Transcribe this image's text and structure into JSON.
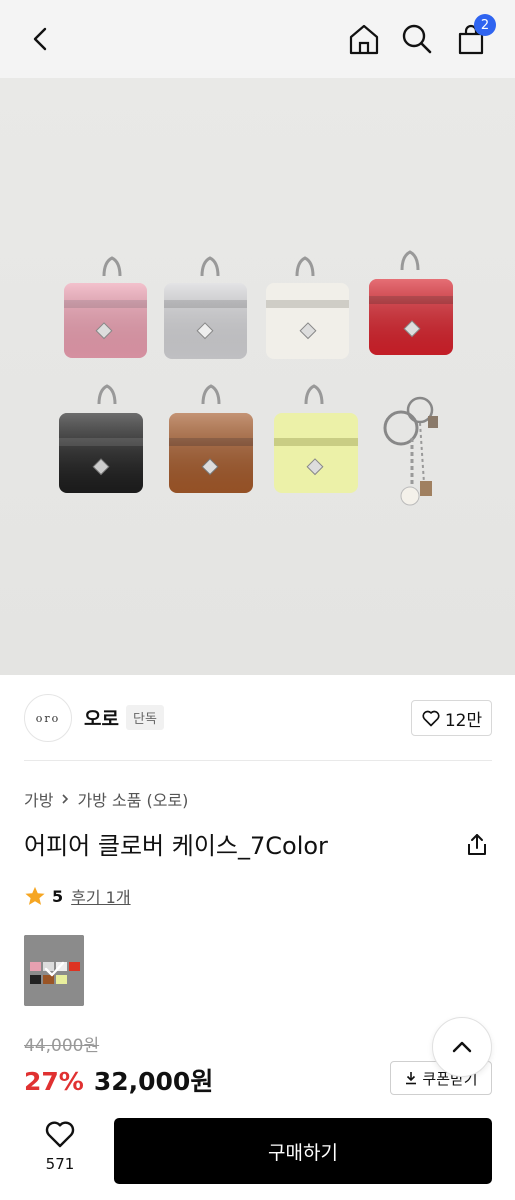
{
  "header": {
    "cart_count": "2"
  },
  "brand": {
    "logo_text": "oro",
    "name": "오로",
    "tag": "단독",
    "like_count": "12만"
  },
  "breadcrumb": {
    "level1": "가방",
    "level2": "가방 소품 (오로)"
  },
  "product": {
    "title": "어피어 클로버 케이스_7Color",
    "rating": "5",
    "reviews_label": "후기 1개",
    "original_price": "44,000원",
    "discount": "27%",
    "price": "32,000원",
    "coupon_label": "쿠폰받기"
  },
  "colors": {
    "accent": "#2f64f0",
    "discount_red": "#e03131",
    "star": "#f6a623"
  },
  "bottom": {
    "wish_count": "571",
    "buy_label": "구매하기"
  }
}
